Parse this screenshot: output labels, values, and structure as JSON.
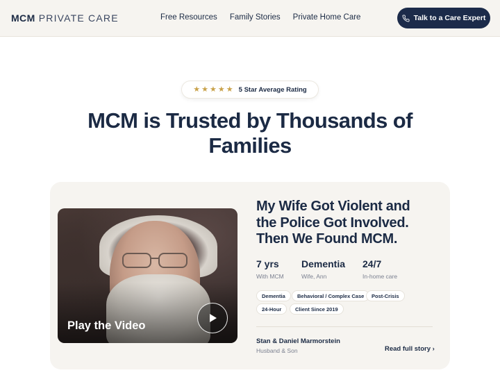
{
  "header": {
    "logo_bold": "MCM",
    "logo_rest": "PRIVATE CARE",
    "nav": [
      {
        "label": "Free Resources"
      },
      {
        "label": "Family Stories"
      },
      {
        "label": "Private Home Care"
      }
    ],
    "cta_label": "Talk to a Care Expert",
    "cta_icon": "phone-icon"
  },
  "rating": {
    "stars": 5,
    "text": "5 Star Average Rating",
    "star_color": "#c9a24a"
  },
  "headline": "MCM is Trusted by Thousands of Families",
  "story": {
    "video_label": "Play the Video",
    "play_icon": "play-icon",
    "title": "My Wife Got Violent and the Police Got Involved. Then We Found MCM.",
    "stats": [
      {
        "value": "7 yrs",
        "label": "With MCM"
      },
      {
        "value": "Dementia",
        "label": "Wife, Ann"
      },
      {
        "value": "24/7",
        "label": "In-home care"
      }
    ],
    "tags": [
      "Dementia",
      "Behavioral / Complex Case",
      "Post-Crisis",
      "24-Hour",
      "Client Since 2019"
    ],
    "person_name": "Stan & Daniel Marmorstein",
    "person_relation": "Husband & Son",
    "read_more": "Read full story ›"
  },
  "colors": {
    "navy": "#1c2b4a",
    "header_bg": "#f6f4f0",
    "card_bg": "#f6f4f0",
    "muted_text": "#7b8090"
  }
}
